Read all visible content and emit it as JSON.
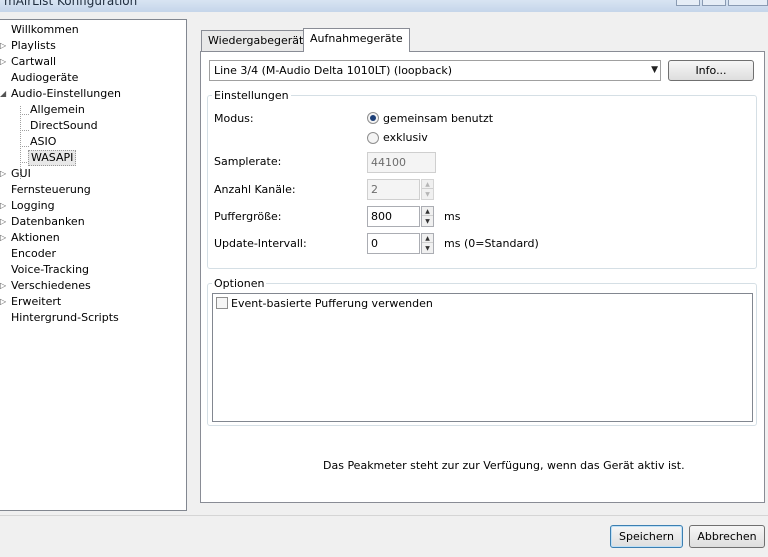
{
  "window": {
    "title": "mAirList Konfiguration"
  },
  "tree": {
    "items": [
      {
        "label": "Willkommen"
      },
      {
        "label": "Playlists"
      },
      {
        "label": "Cartwall"
      },
      {
        "label": "Audiogeräte"
      },
      {
        "label": "Audio-Einstellungen"
      },
      {
        "label": "Allgemein"
      },
      {
        "label": "DirectSound"
      },
      {
        "label": "ASIO"
      },
      {
        "label": "WASAPI"
      },
      {
        "label": "GUI"
      },
      {
        "label": "Fernsteuerung"
      },
      {
        "label": "Logging"
      },
      {
        "label": "Datenbanken"
      },
      {
        "label": "Aktionen"
      },
      {
        "label": "Encoder"
      },
      {
        "label": "Voice-Tracking"
      },
      {
        "label": "Verschiedenes"
      },
      {
        "label": "Erweitert"
      },
      {
        "label": "Hintergrund-Scripts"
      }
    ]
  },
  "tabs": [
    {
      "label": "Wiedergabegeräte"
    },
    {
      "label": "Aufnahmegeräte"
    }
  ],
  "device": {
    "selected": "Line 3/4 (M-Audio Delta 1010LT) (loopback)",
    "info_button": "Info..."
  },
  "settings": {
    "group_title": "Einstellungen",
    "modus_label": "Modus:",
    "modus_options": [
      "gemeinsam benutzt",
      "exklusiv"
    ],
    "samplerate_label": "Samplerate:",
    "samplerate_value": "44100",
    "channels_label": "Anzahl Kanäle:",
    "channels_value": "2",
    "buffer_label": "Puffergröße:",
    "buffer_value": "800",
    "buffer_unit": "ms",
    "update_label": "Update-Intervall:",
    "update_value": "0",
    "update_unit": "ms (0=Standard)"
  },
  "options": {
    "group_title": "Optionen",
    "items": [
      {
        "label": "Event-basierte Pufferung verwenden",
        "checked": false
      }
    ]
  },
  "peakmeter_note": "Das Peakmeter steht zur zur Verfügung, wenn das Gerät aktiv ist.",
  "footer": {
    "save": "Speichern",
    "cancel": "Abbrechen"
  }
}
